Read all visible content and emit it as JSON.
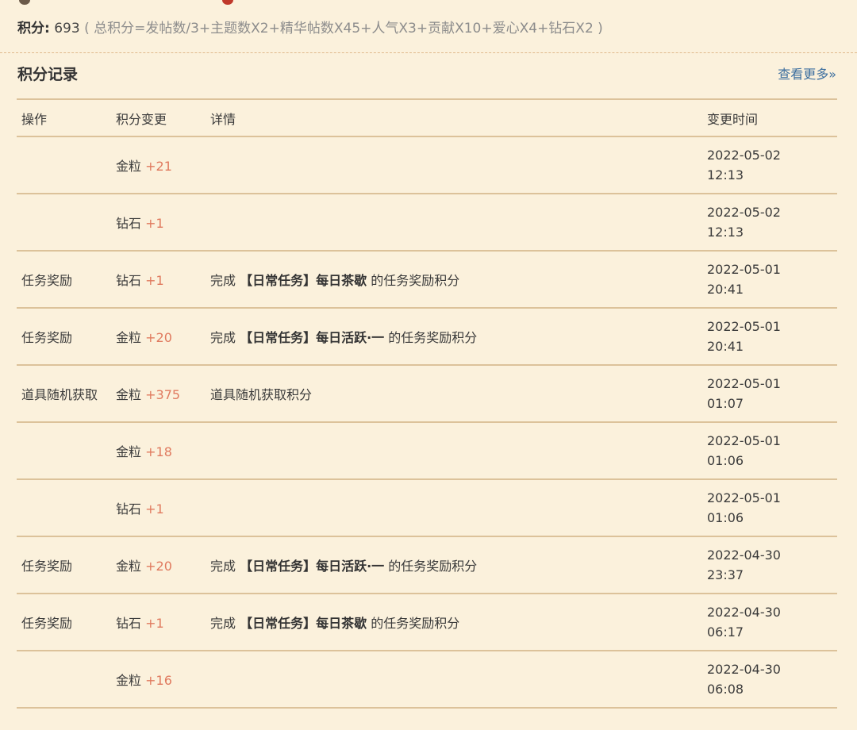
{
  "header": {
    "score_label": "积分:",
    "score_value": "693",
    "formula": "( 总积分=发帖数/3+主题数X2+精华帖数X45+人气X3+贡献X10+爱心X4+钻石X2 )"
  },
  "section": {
    "title": "积分记录",
    "more_link": "查看更多»"
  },
  "table": {
    "columns": [
      "操作",
      "积分变更",
      "详情",
      "变更时间"
    ],
    "rows": [
      {
        "op": "",
        "type": "金粒",
        "amount": "+21",
        "detail_pre": "",
        "detail_bold": "",
        "detail_post": "",
        "date": "2022-05-02",
        "time": "12:13"
      },
      {
        "op": "",
        "type": "钻石",
        "amount": "+1",
        "detail_pre": "",
        "detail_bold": "",
        "detail_post": "",
        "date": "2022-05-02",
        "time": "12:13"
      },
      {
        "op": "任务奖励",
        "type": "钻石",
        "amount": "+1",
        "detail_pre": "完成 ",
        "detail_bold": "【日常任务】每日茶歇",
        "detail_post": " 的任务奖励积分",
        "date": "2022-05-01",
        "time": "20:41"
      },
      {
        "op": "任务奖励",
        "type": "金粒",
        "amount": "+20",
        "detail_pre": "完成 ",
        "detail_bold": "【日常任务】每日活跃·一",
        "detail_post": " 的任务奖励积分",
        "date": "2022-05-01",
        "time": "20:41"
      },
      {
        "op": "道具随机获取",
        "type": "金粒",
        "amount": "+375",
        "detail_pre": "道具随机获取积分",
        "detail_bold": "",
        "detail_post": "",
        "date": "2022-05-01",
        "time": "01:07"
      },
      {
        "op": "",
        "type": "金粒",
        "amount": "+18",
        "detail_pre": "",
        "detail_bold": "",
        "detail_post": "",
        "date": "2022-05-01",
        "time": "01:06"
      },
      {
        "op": "",
        "type": "钻石",
        "amount": "+1",
        "detail_pre": "",
        "detail_bold": "",
        "detail_post": "",
        "date": "2022-05-01",
        "time": "01:06"
      },
      {
        "op": "任务奖励",
        "type": "金粒",
        "amount": "+20",
        "detail_pre": "完成 ",
        "detail_bold": "【日常任务】每日活跃·一",
        "detail_post": " 的任务奖励积分",
        "date": "2022-04-30",
        "time": "23:37"
      },
      {
        "op": "任务奖励",
        "type": "钻石",
        "amount": "+1",
        "detail_pre": "完成 ",
        "detail_bold": "【日常任务】每日茶歇",
        "detail_post": " 的任务奖励积分",
        "date": "2022-04-30",
        "time": "06:17"
      },
      {
        "op": "",
        "type": "金粒",
        "amount": "+16",
        "detail_pre": "",
        "detail_bold": "",
        "detail_post": "",
        "date": "2022-04-30",
        "time": "06:08"
      }
    ]
  },
  "colors": {
    "background": "#fbf1dc",
    "rule": "#dcc29a",
    "accent_plus": "#e07a5f",
    "link": "#3d6f9f"
  }
}
